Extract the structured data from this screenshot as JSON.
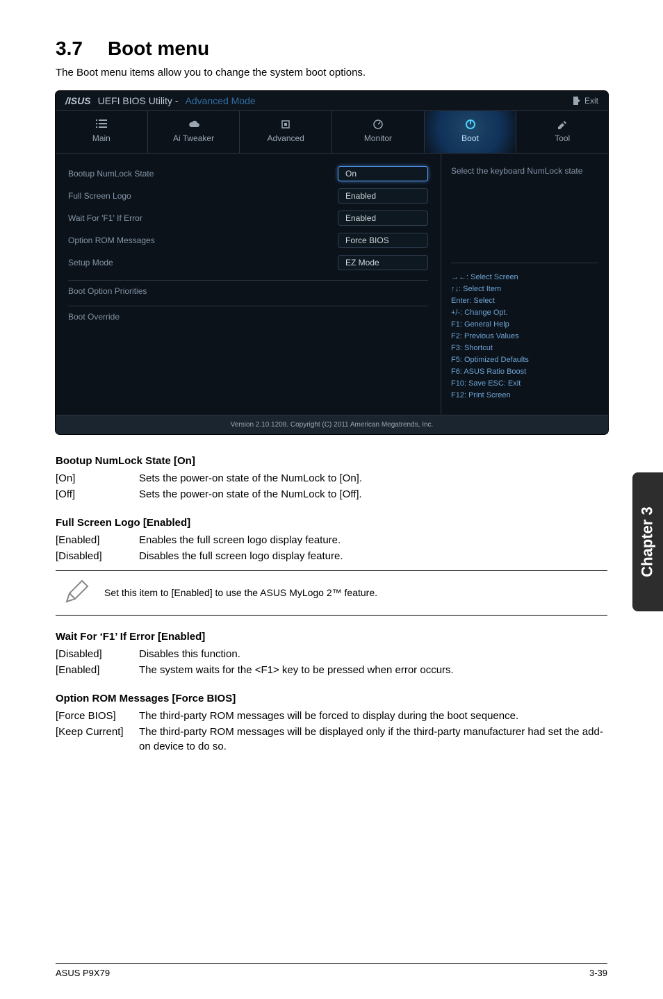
{
  "header": {
    "section_number": "3.7",
    "section_title": "Boot menu",
    "intro": "The Boot menu items allow you to change the system boot options."
  },
  "bios": {
    "brand": "/ISUS",
    "title_app": "UEFI BIOS Utility -",
    "title_mode": "Advanced Mode",
    "exit_label": "Exit",
    "tabs": [
      {
        "label": "Main"
      },
      {
        "label": "Ai Tweaker"
      },
      {
        "label": "Advanced"
      },
      {
        "label": "Monitor"
      },
      {
        "label": "Boot"
      },
      {
        "label": "Tool"
      }
    ],
    "options": [
      {
        "label": "Bootup NumLock State",
        "value": "On",
        "active": true
      },
      {
        "label": "Full Screen Logo",
        "value": "Enabled"
      },
      {
        "label": "Wait For 'F1' If Error",
        "value": "Enabled"
      },
      {
        "label": "Option ROM Messages",
        "value": "Force BIOS"
      },
      {
        "label": "Setup Mode",
        "value": "EZ Mode"
      }
    ],
    "section_a": "Boot Option Priorities",
    "section_b": "Boot Override",
    "help_text": "Select the keyboard NumLock state",
    "help_keys": [
      "→←: Select Screen",
      "↑↓: Select Item",
      "Enter: Select",
      "+/-: Change Opt.",
      "F1: General Help",
      "F2: Previous Values",
      "F3: Shortcut",
      "F5: Optimized Defaults",
      "F6: ASUS Ratio Boost",
      "F10: Save  ESC: Exit",
      "F12: Print Screen"
    ],
    "footer": "Version 2.10.1208. Copyright (C) 2011 American Megatrends, Inc."
  },
  "doc": {
    "sub1_head": "Bootup NumLock State [On]",
    "sub1_rows": [
      {
        "term": "[On]",
        "desc": "Sets the power-on state of the NumLock to [On]."
      },
      {
        "term": "[Off]",
        "desc": "Sets the power-on state of the NumLock to [Off]."
      }
    ],
    "sub2_head": "Full Screen Logo [Enabled]",
    "sub2_rows": [
      {
        "term": "[Enabled]",
        "desc": "Enables the full screen logo display feature."
      },
      {
        "term": "[Disabled]",
        "desc": "Disables the full screen logo display feature."
      }
    ],
    "note_text": "Set this item to [Enabled] to use the ASUS MyLogo 2™ feature.",
    "sub3_head": "Wait For ‘F1’ If Error [Enabled]",
    "sub3_rows": [
      {
        "term": "[Disabled]",
        "desc": "Disables this function."
      },
      {
        "term": "[Enabled]",
        "desc": "The system waits for the <F1> key to be pressed when error occurs."
      }
    ],
    "sub4_head": "Option ROM Messages [Force BIOS]",
    "sub4_rows": [
      {
        "term": "[Force BIOS]",
        "desc": "The third-party ROM messages will be forced to display during the boot sequence."
      },
      {
        "term": "[Keep Current]",
        "desc": "The third-party ROM messages will be displayed only if the third-party manufacturer had set the add-on device to do so."
      }
    ]
  },
  "side_tab": "Chapter 3",
  "footer": {
    "left": "ASUS P9X79",
    "right": "3-39"
  }
}
